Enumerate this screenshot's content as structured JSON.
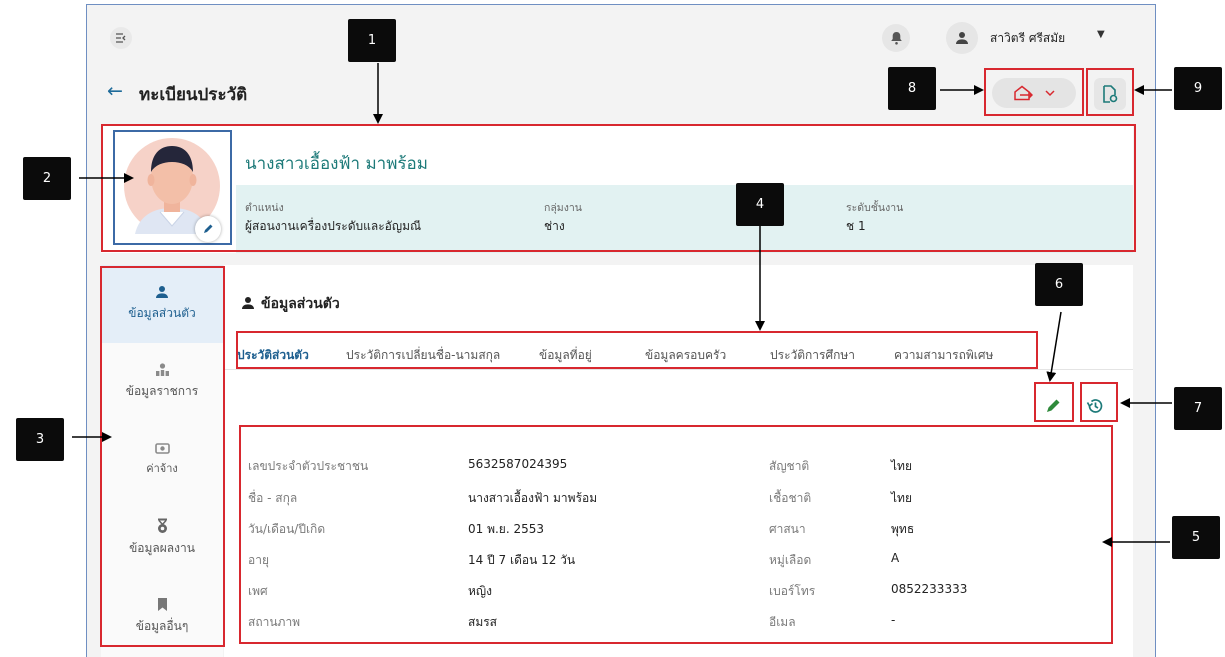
{
  "topbar": {
    "user_name": "สาวิตรี ศรีสมัย"
  },
  "page": {
    "title": "ทะเบียนประวัติ"
  },
  "profile": {
    "name": "นางสาวเอื้องฟ้า มาพร้อม",
    "fields": [
      {
        "label": "ตำแหน่ง",
        "value": "ผู้สอนงานเครื่องประดับและอัญมณี"
      },
      {
        "label": "กลุ่มงาน",
        "value": "ช่าง"
      },
      {
        "label": "ระดับชั้นงาน",
        "value": "ช 1"
      }
    ]
  },
  "sidebar": {
    "items": [
      {
        "label": "ข้อมูลส่วนตัว",
        "icon": "person-icon",
        "active": true
      },
      {
        "label": "ข้อมูลราชการ",
        "icon": "org-icon",
        "active": false
      },
      {
        "label": "ค่าจ้าง",
        "icon": "money-icon",
        "active": false
      },
      {
        "label": "ข้อมูลผลงาน",
        "icon": "medal-icon",
        "active": false
      },
      {
        "label": "ข้อมูลอื่นๆ",
        "icon": "bookmark-icon",
        "active": false
      }
    ]
  },
  "main": {
    "section_title": "ข้อมูลส่วนตัว",
    "tabs": [
      {
        "label": "ประวัติส่วนตัว",
        "active": true
      },
      {
        "label": "ประวัติการเปลี่ยนชื่อ-นามสกุล",
        "active": false
      },
      {
        "label": "ข้อมูลที่อยู่",
        "active": false
      },
      {
        "label": "ข้อมูลครอบครัว",
        "active": false
      },
      {
        "label": "ประวัติการศึกษา",
        "active": false
      },
      {
        "label": "ความสามารถพิเศษ",
        "active": false
      }
    ],
    "info_left": [
      {
        "label": "เลขประจำตัวประชาชน",
        "value": "5632587024395"
      },
      {
        "label": "ชื่อ - สกุล",
        "value": "นางสาวเอื้องฟ้า มาพร้อม"
      },
      {
        "label": "วัน/เดือน/ปีเกิด",
        "value": "01 พ.ย. 2553"
      },
      {
        "label": "อายุ",
        "value": "14 ปี 7 เดือน 12 วัน"
      },
      {
        "label": "เพศ",
        "value": "หญิง"
      },
      {
        "label": "สถานภาพ",
        "value": "สมรส"
      }
    ],
    "info_right": [
      {
        "label": "สัญชาติ",
        "value": "ไทย"
      },
      {
        "label": "เชื้อชาติ",
        "value": "ไทย"
      },
      {
        "label": "ศาสนา",
        "value": "พุทธ"
      },
      {
        "label": "หมู่เลือด",
        "value": "A"
      },
      {
        "label": "เบอร์โทร",
        "value": "0852233333"
      },
      {
        "label": "อีเมล",
        "value": "-"
      }
    ]
  },
  "callouts": [
    "1",
    "2",
    "3",
    "4",
    "5",
    "6",
    "7",
    "8",
    "9"
  ],
  "colors": {
    "accent": "#1e5f8f",
    "teal": "#1d7a79",
    "teal_bg": "#e2f2f2",
    "highlight": "#d8282f",
    "frame": "#6f8fc2"
  }
}
